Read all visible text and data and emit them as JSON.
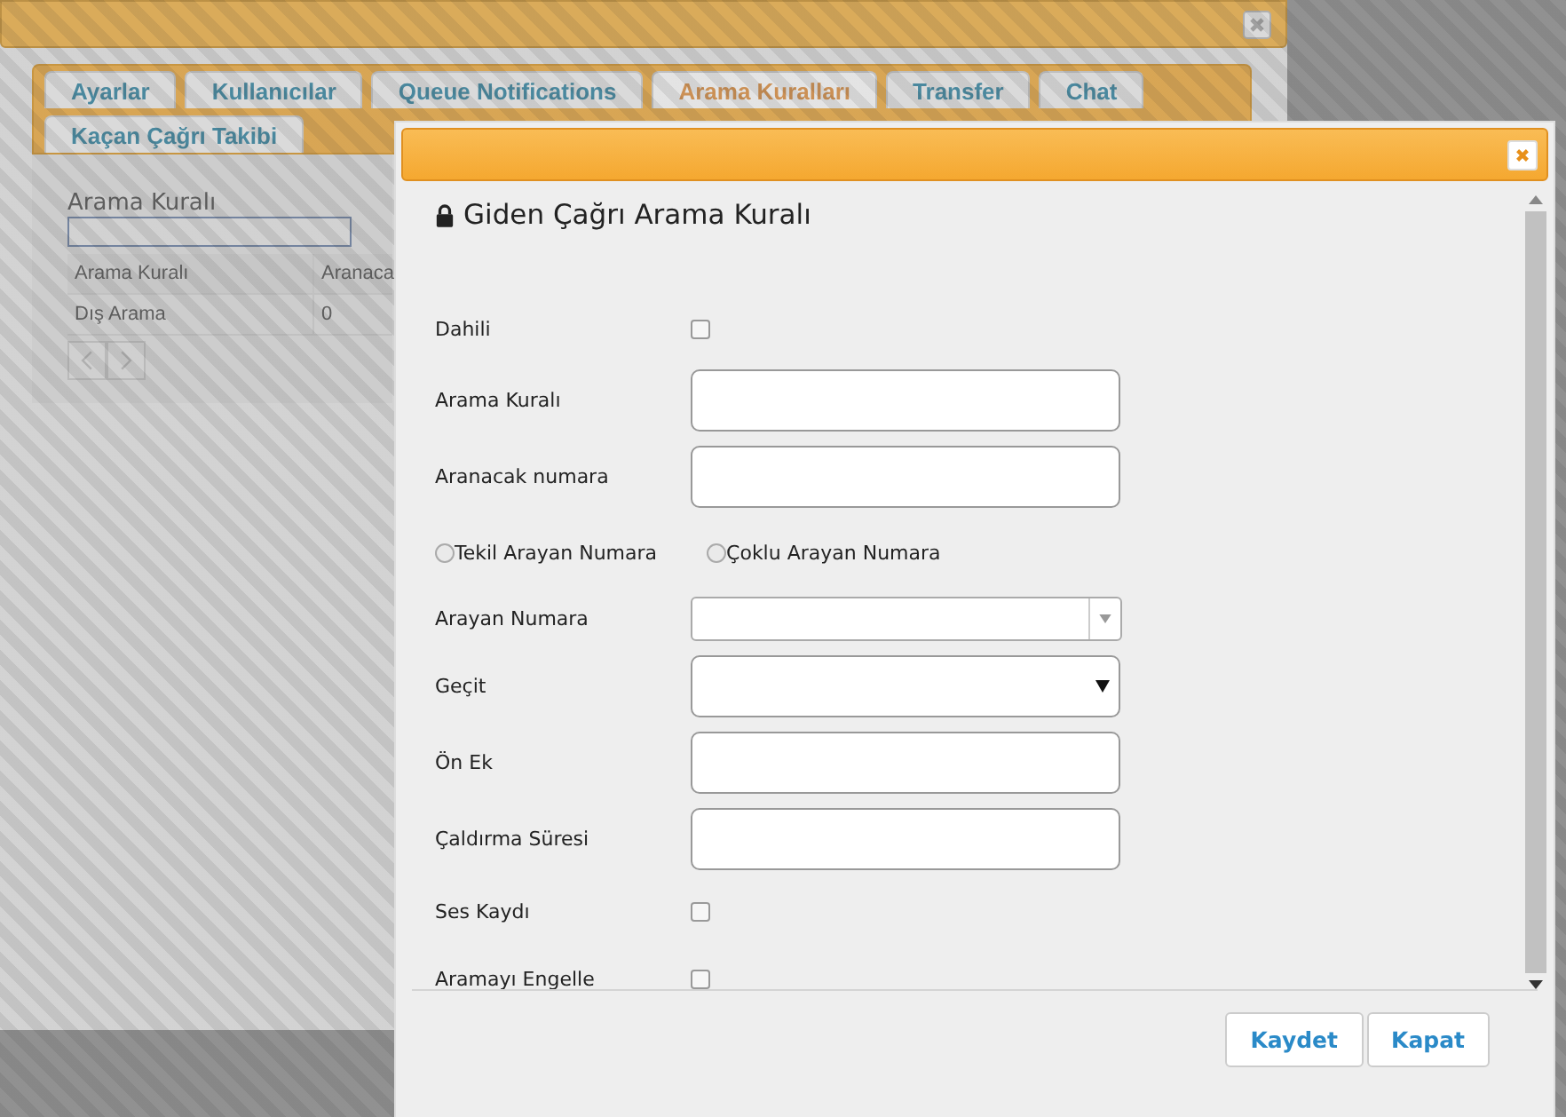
{
  "background_window": {
    "tabs": [
      {
        "label": "Ayarlar",
        "selected": false
      },
      {
        "label": "Kullanıcılar",
        "selected": false
      },
      {
        "label": "Queue Notifications",
        "selected": false
      },
      {
        "label": "Arama Kuralları",
        "selected": true
      },
      {
        "label": "Transfer",
        "selected": false
      },
      {
        "label": "Chat",
        "selected": false
      },
      {
        "label": "Kaçan Çağrı Takibi",
        "selected": false
      }
    ],
    "search": {
      "label": "Arama Kuralı"
    },
    "table": {
      "columns": [
        "Arama Kuralı",
        "Aranaca"
      ],
      "rows": [
        [
          "Dış Arama",
          "0"
        ]
      ]
    }
  },
  "dialog": {
    "title": "Giden Çağrı Arama Kuralı",
    "fields": [
      {
        "kind": "checkbox",
        "label": "Dahili",
        "checked": false
      },
      {
        "kind": "text",
        "label": "Arama Kuralı"
      },
      {
        "kind": "text",
        "label": "Aranacak numara"
      },
      {
        "kind": "radio",
        "options": [
          {
            "label": "Tekil Arayan Numara",
            "selected": false
          },
          {
            "label": "Çoklu Arayan Numara",
            "selected": false
          }
        ]
      },
      {
        "kind": "combo",
        "label": "Arayan Numara"
      },
      {
        "kind": "select",
        "label": "Geçit"
      },
      {
        "kind": "text",
        "label": "Ön Ek"
      },
      {
        "kind": "text",
        "label": "Çaldırma Süresi"
      },
      {
        "kind": "checkbox",
        "label": "Ses Kaydı",
        "checked": false
      },
      {
        "kind": "checkbox",
        "label": "Aramayı Engelle",
        "checked": false
      }
    ],
    "buttons": [
      "Kaydet",
      "Kapat"
    ]
  }
}
